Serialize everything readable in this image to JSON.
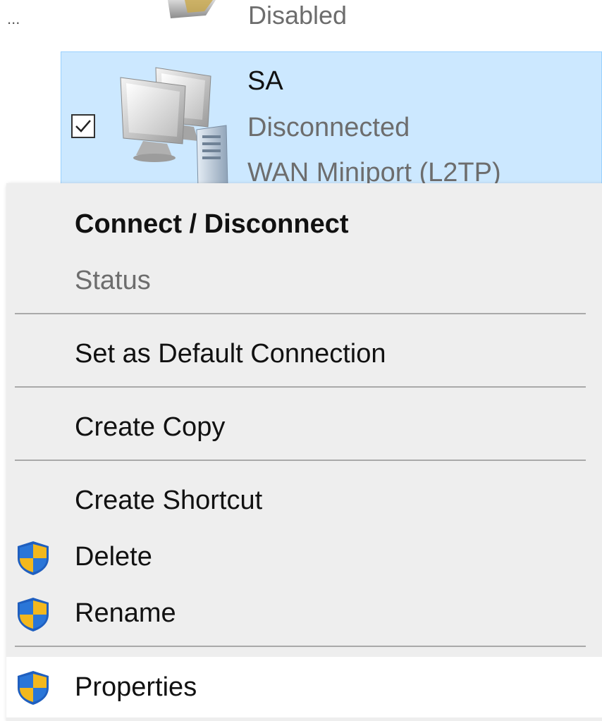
{
  "previous_item": {
    "ellipsis": "...",
    "status": "Disabled"
  },
  "connection": {
    "name": "SA",
    "status": "Disconnected",
    "device": "WAN Miniport (L2TP)",
    "checked": true
  },
  "context_menu": {
    "items": [
      {
        "label": "Connect / Disconnect",
        "bold": true,
        "disabled": false,
        "shield": false
      },
      {
        "label": "Status",
        "bold": false,
        "disabled": true,
        "shield": false
      },
      {
        "label": "Set as Default Connection",
        "bold": false,
        "disabled": false,
        "shield": false
      },
      {
        "label": "Create Copy",
        "bold": false,
        "disabled": false,
        "shield": false
      },
      {
        "label": "Create Shortcut",
        "bold": false,
        "disabled": false,
        "shield": false
      },
      {
        "label": "Delete",
        "bold": false,
        "disabled": false,
        "shield": true
      },
      {
        "label": "Rename",
        "bold": false,
        "disabled": false,
        "shield": true
      },
      {
        "label": "Properties",
        "bold": false,
        "disabled": false,
        "shield": true,
        "hovered": true
      }
    ]
  },
  "icons": {
    "checkbox": "checkmark-icon",
    "connection": "network-computers-icon",
    "uac": "uac-shield-icon"
  },
  "colors": {
    "selection_bg": "#cce8ff",
    "selection_border": "#99d1ff",
    "menu_bg": "#eeeeee",
    "hover_bg": "#ffffff",
    "disabled_text": "#6d6d6d"
  }
}
